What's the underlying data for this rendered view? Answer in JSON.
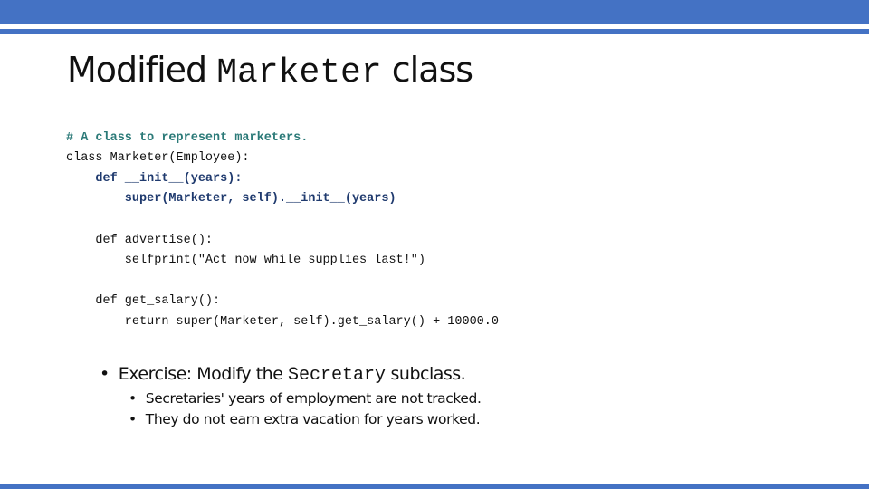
{
  "slide": {
    "title": {
      "prefix": "Modified ",
      "code": "Marketer",
      "suffix": " class"
    },
    "code_lines": [
      {
        "text": "# A class to represent marketers.",
        "style": "comment"
      },
      {
        "text": "class Marketer(Employee):",
        "style": "plain"
      },
      {
        "text": "    def __init__(years):",
        "style": "keyword"
      },
      {
        "text": "        super(Marketer, self).__init__(years)",
        "style": "keyword"
      },
      {
        "text": "",
        "style": "plain"
      },
      {
        "text": "    def advertise():",
        "style": "plain"
      },
      {
        "text": "        selfprint(\"Act now while supplies last!\")",
        "style": "plain"
      },
      {
        "text": "",
        "style": "plain"
      },
      {
        "text": "    def get_salary():",
        "style": "plain"
      },
      {
        "text": "        return super(Marketer, self).get_salary() + 10000.0",
        "style": "plain"
      }
    ],
    "bullet": {
      "marker": "•",
      "prefix": "Exercise: Modify the ",
      "code": "Secretary",
      "suffix": " subclass."
    },
    "sub_bullets": [
      {
        "marker": "•",
        "text": "Secretaries' years of employment are not tracked."
      },
      {
        "marker": "•",
        "text": "They do not earn extra vacation for years worked."
      }
    ],
    "colors": {
      "accent": "#4472C4",
      "comment": "#2b7a78",
      "keyword": "#1f3a6e"
    }
  }
}
